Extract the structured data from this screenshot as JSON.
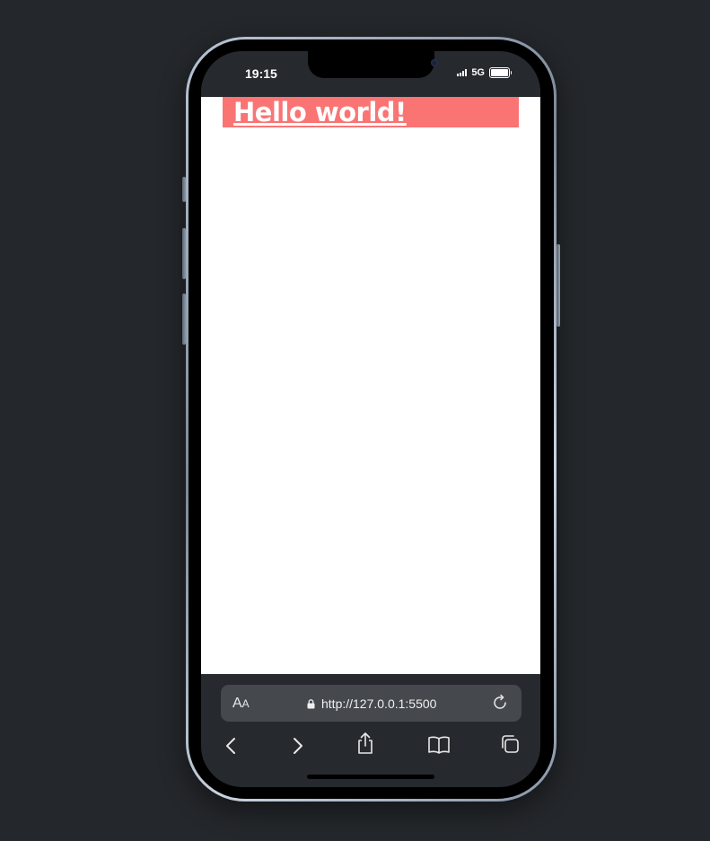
{
  "status_bar": {
    "time": "19:15",
    "network": "5G",
    "battery_level": 1.0
  },
  "page": {
    "heading": "Hello world!",
    "heading_background": "#fa7474",
    "heading_color": "#ffffff"
  },
  "browser": {
    "text_size_label": "A",
    "text_size_label_small": "A",
    "url": "http://127.0.0.1:5500",
    "lock_icon": "lock-icon",
    "reload_icon": "reload-icon"
  },
  "toolbar": {
    "icons": [
      "back-icon",
      "forward-icon",
      "share-icon",
      "bookmarks-icon",
      "tabs-icon"
    ]
  },
  "colors": {
    "background": "#24272b",
    "browser_chrome": "#26292e",
    "address_bar": "#45484d"
  }
}
